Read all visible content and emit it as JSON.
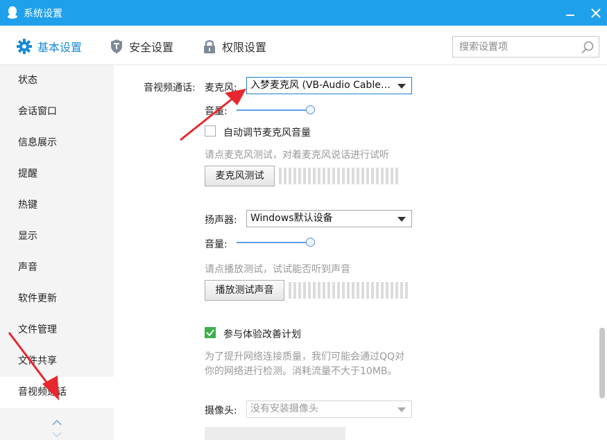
{
  "window": {
    "title": "系统设置",
    "icons": {
      "app": "qq-penguin-icon",
      "minimize": "minimize-icon",
      "close": "close-icon"
    }
  },
  "tabs": [
    {
      "label": "基本设置",
      "icon": "gear-icon",
      "active": true
    },
    {
      "label": "安全设置",
      "icon": "shield-icon",
      "active": false
    },
    {
      "label": "权限设置",
      "icon": "lock-icon",
      "active": false
    }
  ],
  "search": {
    "placeholder": "搜索设置项",
    "value": "",
    "icon": "search-icon"
  },
  "sidebar": {
    "items": [
      {
        "label": "状态"
      },
      {
        "label": "会话窗口"
      },
      {
        "label": "信息展示"
      },
      {
        "label": "提醒"
      },
      {
        "label": "热键"
      },
      {
        "label": "显示"
      },
      {
        "label": "声音"
      },
      {
        "label": "软件更新"
      },
      {
        "label": "文件管理"
      },
      {
        "label": "文件共享"
      },
      {
        "label": "音视频通话",
        "active": true
      }
    ],
    "scroll_icon": "chevron-up-down-icon"
  },
  "av": {
    "section_label": "音视频通话:",
    "mic": {
      "label": "麦克风:",
      "device": "入梦麦克风 (VB-Audio Cable A)",
      "volume_label": "音量:",
      "volume_level": 1.0,
      "auto_adjust": {
        "label": "自动调节麦克风音量",
        "checked": false
      },
      "hint": "请点麦克风测试，对着麦克风说话进行试听",
      "test_button": "麦克风测试"
    },
    "speaker": {
      "label": "扬声器:",
      "device": "Windows默认设备",
      "volume_label": "音量:",
      "volume_level": 1.0,
      "hint": "请点播放测试，试试能否听到声音",
      "test_button": "播放测试声音"
    },
    "improve": {
      "label": "参与体验改善计划",
      "checked": true,
      "desc_line1": "为了提升网络连接质量，我们可能会通过QQ对",
      "desc_line2": "你的网络进行检测。消耗流量不大于10MB。"
    },
    "camera": {
      "label": "摄像头:",
      "device": "没有安装摄像头"
    }
  },
  "colors": {
    "titlebar": "#1fa0ea",
    "accent": "#1a8ad6",
    "annotation": "#e8262d",
    "checked": "#3bb04a"
  }
}
